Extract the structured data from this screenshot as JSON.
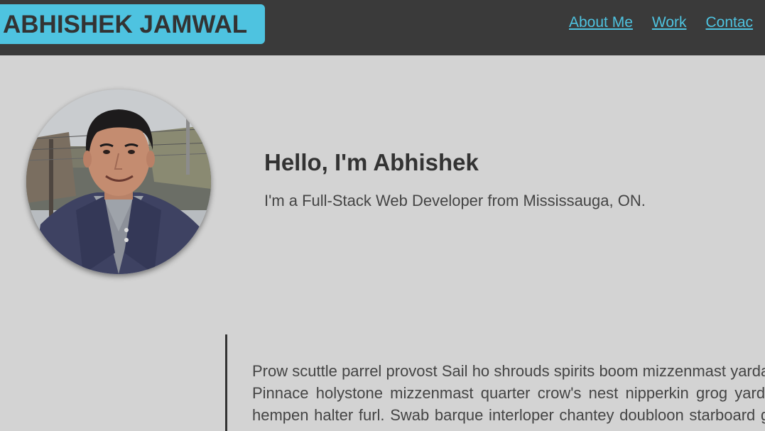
{
  "header": {
    "brand": "ABHISHEK JAMWAL",
    "nav": [
      {
        "label": "About Me"
      },
      {
        "label": "Work"
      },
      {
        "label": "Contac"
      }
    ]
  },
  "hero": {
    "greeting": "Hello, I'm Abhishek",
    "tagline": "I'm a Full-Stack Web Developer from Mississauga, ON.",
    "avatar": "profile-photo"
  },
  "about": {
    "text": "Prow scuttle parrel provost Sail ho shrouds spirits boom mizzenmast yardarm. Pinnace holystone mizzenmast quarter crow's nest nipperkin grog yardarm hempen halter furl. Swab barque interloper chantey doubloon starboard grog black jack gangway rutters."
  },
  "colors": {
    "header_bg": "#3a3a3a",
    "accent": "#4ec3e0",
    "page_bg": "#d3d3d3",
    "text": "#333333"
  }
}
